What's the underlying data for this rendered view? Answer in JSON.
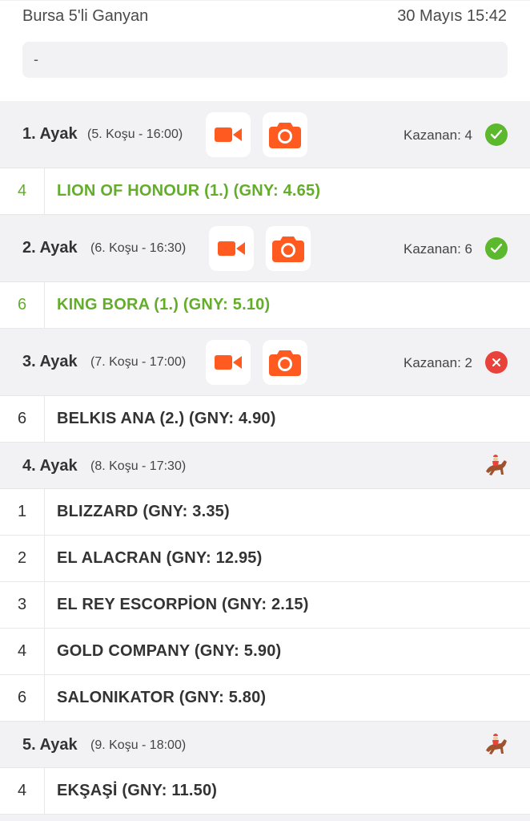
{
  "header": {
    "title": "Bursa 5'li Ganyan",
    "date": "30 Mayıs 15:42",
    "note": "-"
  },
  "colors": {
    "accent": "#ff5a1f",
    "winner": "#63ad2b",
    "success": "#5cb82c",
    "fail": "#e8423a",
    "header_bg": "#f2f2f4"
  },
  "legs": [
    {
      "title": "1. Ayak",
      "sub": "(5. Koşu - 16:00)",
      "kazanan": "Kazanan: 4",
      "status": "check-icon",
      "horses": [
        {
          "num": "4",
          "name": "LION OF HONOUR (1.) (GNY: 4.65)",
          "winner": true
        }
      ]
    },
    {
      "title": "2. Ayak",
      "sub": "(6. Koşu - 16:30)",
      "kazanan": "Kazanan: 6",
      "status": "check-icon",
      "horses": [
        {
          "num": "6",
          "name": "KING BORA (1.) (GNY: 5.10)",
          "winner": true
        }
      ]
    },
    {
      "title": "3. Ayak",
      "sub": "(7. Koşu - 17:00)",
      "kazanan": "Kazanan: 2",
      "status": "x-icon",
      "horses": [
        {
          "num": "6",
          "name": "BELKIS ANA (2.) (GNY: 4.90)",
          "winner": false
        }
      ]
    },
    {
      "title": "4. Ayak",
      "sub": "(8. Koşu - 17:30)",
      "status": "horse-icon",
      "horses": [
        {
          "num": "1",
          "name": "BLIZZARD (GNY: 3.35)"
        },
        {
          "num": "2",
          "name": "EL ALACRAN (GNY: 12.95)"
        },
        {
          "num": "3",
          "name": "EL REY ESCORPİON (GNY: 2.15)"
        },
        {
          "num": "4",
          "name": "GOLD COMPANY (GNY: 5.90)"
        },
        {
          "num": "6",
          "name": "SALONIKATOR (GNY: 5.80)"
        }
      ]
    },
    {
      "title": "5. Ayak",
      "sub": "(9. Koşu - 18:00)",
      "status": "horse-icon",
      "horses": [
        {
          "num": "4",
          "name": "EKŞAŞİ (GNY: 11.50)"
        }
      ]
    }
  ]
}
